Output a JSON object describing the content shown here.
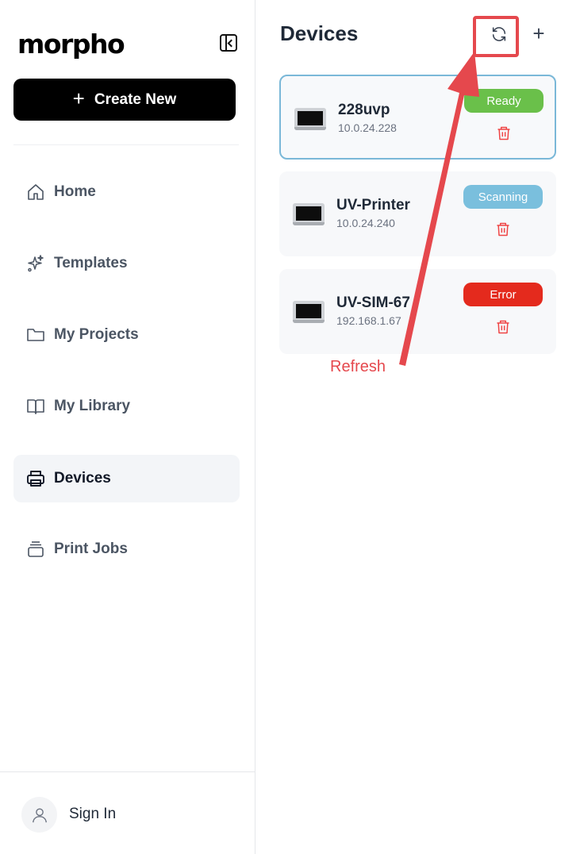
{
  "sidebar": {
    "logo": "morpho",
    "create_label": "Create New",
    "items": [
      {
        "label": "Home",
        "icon": "home-icon"
      },
      {
        "label": "Templates",
        "icon": "sparkles-icon"
      },
      {
        "label": "My Projects",
        "icon": "folder-icon"
      },
      {
        "label": "My Library",
        "icon": "book-icon"
      },
      {
        "label": "Devices",
        "icon": "printer-icon",
        "active": true
      },
      {
        "label": "Print Jobs",
        "icon": "stack-icon"
      }
    ],
    "sign_in": "Sign In"
  },
  "main": {
    "title": "Devices",
    "devices": [
      {
        "name": "228uvp",
        "ip": "10.0.24.228",
        "status": "Ready",
        "status_color": "#6ac04a",
        "selected": true
      },
      {
        "name": "UV-Printer",
        "ip": "10.0.24.240",
        "status": "Scanning",
        "status_color": "#7abfdd",
        "selected": false
      },
      {
        "name": "UV-SIM-67",
        "ip": "192.168.1.67",
        "status": "Error",
        "status_color": "#e42a1d",
        "selected": false
      }
    ]
  },
  "annotation": {
    "label": "Refresh",
    "color": "#e5484d"
  }
}
